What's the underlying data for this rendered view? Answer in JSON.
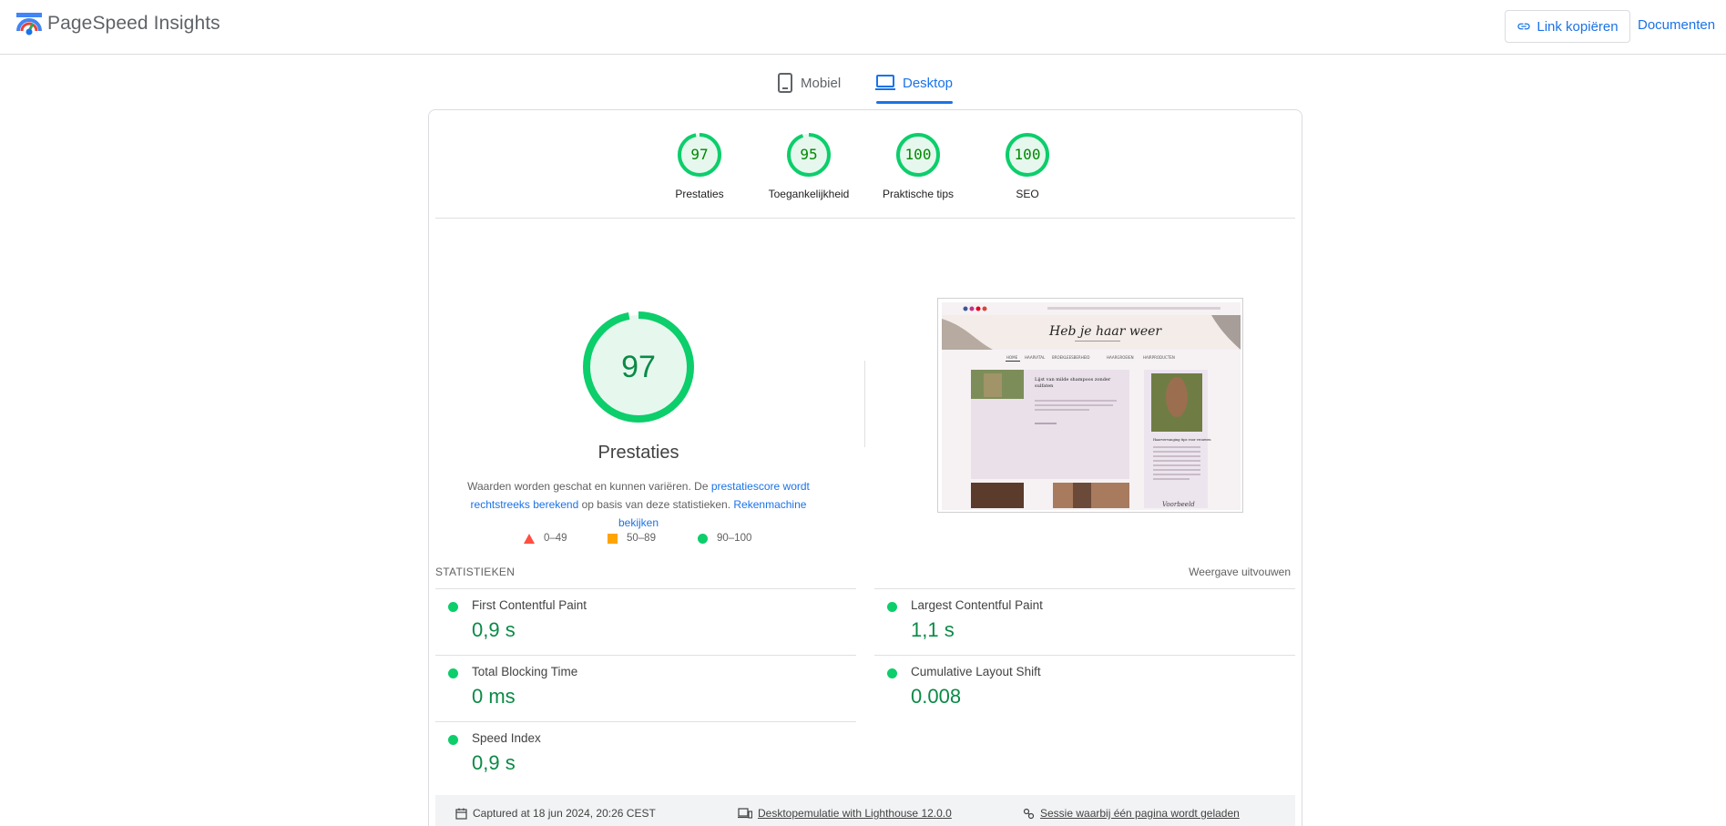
{
  "header": {
    "brand": "PageSpeed Insights",
    "copy_link_label": "Link kopiëren",
    "docs_label": "Documenten"
  },
  "tabs": [
    {
      "label": "Mobiel",
      "icon": "smartphone-icon",
      "selected": false
    },
    {
      "label": "Desktop",
      "icon": "laptop-icon",
      "selected": true
    }
  ],
  "scores": [
    {
      "value": "97",
      "label": "Prestaties",
      "fraction": 0.97
    },
    {
      "value": "95",
      "label": "Toegankelijkheid",
      "fraction": 0.95
    },
    {
      "value": "100",
      "label": "Praktische tips",
      "fraction": 1.0
    },
    {
      "value": "100",
      "label": "SEO",
      "fraction": 1.0
    }
  ],
  "performance": {
    "score": "97",
    "fraction": 0.97,
    "title": "Prestaties",
    "desc_part1": "Waarden worden geschat en kunnen variëren. De ",
    "desc_link1": "prestatiescore wordt rechtstreeks berekend",
    "desc_part2": " op basis van deze statistieken. ",
    "desc_link2": "Rekenmachine bekijken"
  },
  "legend": [
    {
      "range": "0–49",
      "shape": "triangle",
      "color": "#ff4e42"
    },
    {
      "range": "50–89",
      "shape": "square",
      "color": "#ffa400"
    },
    {
      "range": "90–100",
      "shape": "circle",
      "color": "#0cce6b"
    }
  ],
  "thumbnail": {
    "site_title": "Heb je haar weer",
    "nav": [
      "HOME",
      "HAARVITAL",
      "BROEKLEESBERHEID",
      "HAARGROEIEN",
      "HAIRPRODUCTEN"
    ],
    "post_title": "Lijst van milde shampoos zonder sulfaten",
    "sidebar_heading": "Haarvervanging tips voor vrouwen",
    "footer_script": "Voorbeeld"
  },
  "stats": {
    "heading": "STATISTIEKEN",
    "expand_label": "Weergave uitvouwen",
    "metrics": [
      {
        "name": "First Contentful Paint",
        "value": "0,9 s"
      },
      {
        "name": "Largest Contentful Paint",
        "value": "1,1 s"
      },
      {
        "name": "Total Blocking Time",
        "value": "0 ms"
      },
      {
        "name": "Cumulative Layout Shift",
        "value": "0.008"
      },
      {
        "name": "Speed Index",
        "value": "0,9 s"
      }
    ]
  },
  "footer": {
    "captured": "Captured at 18 jun 2024, 20:26 CEST",
    "emulation": "Desktopemulatie with Lighthouse 12.0.0",
    "session": "Sessie waarbij één pagina wordt geladen"
  },
  "colors": {
    "accent": "#1a73e8",
    "pass": "#0cce6b",
    "pass_text": "#0a8a46",
    "average": "#ffa400",
    "fail": "#ff4e42"
  }
}
